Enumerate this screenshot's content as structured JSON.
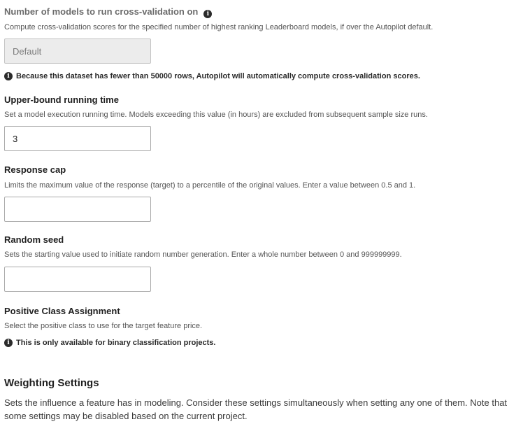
{
  "cv_models": {
    "title": "Number of models to run cross-validation on",
    "description": "Compute cross-validation scores for the specified number of highest ranking Leaderboard models, if over the Autopilot default.",
    "input_placeholder": "Default",
    "note": "Because this dataset has fewer than 50000 rows, Autopilot will automatically compute cross-validation scores."
  },
  "running_time": {
    "title": "Upper-bound running time",
    "description": "Set a model execution running time. Models exceeding this value (in hours) are excluded from subsequent sample size runs.",
    "input_value": "3"
  },
  "response_cap": {
    "title": "Response cap",
    "description": "Limits the maximum value of the response (target) to a percentile of the original values. Enter a value between 0.5 and 1.",
    "input_value": ""
  },
  "random_seed": {
    "title": "Random seed",
    "description": "Sets the starting value used to initiate random number generation. Enter a whole number between 0 and 999999999.",
    "input_value": ""
  },
  "positive_class": {
    "title": "Positive Class Assignment",
    "description": "Select the positive class to use for the target feature price.",
    "note": "This is only available for binary classification projects."
  },
  "weighting": {
    "heading": "Weighting Settings",
    "description": "Sets the influence a feature has in modeling. Consider these settings simultaneously when setting any one of them. Note that some settings may be disabled based on the current project."
  },
  "icons": {
    "info": "info-icon",
    "info_glyph": "i"
  }
}
